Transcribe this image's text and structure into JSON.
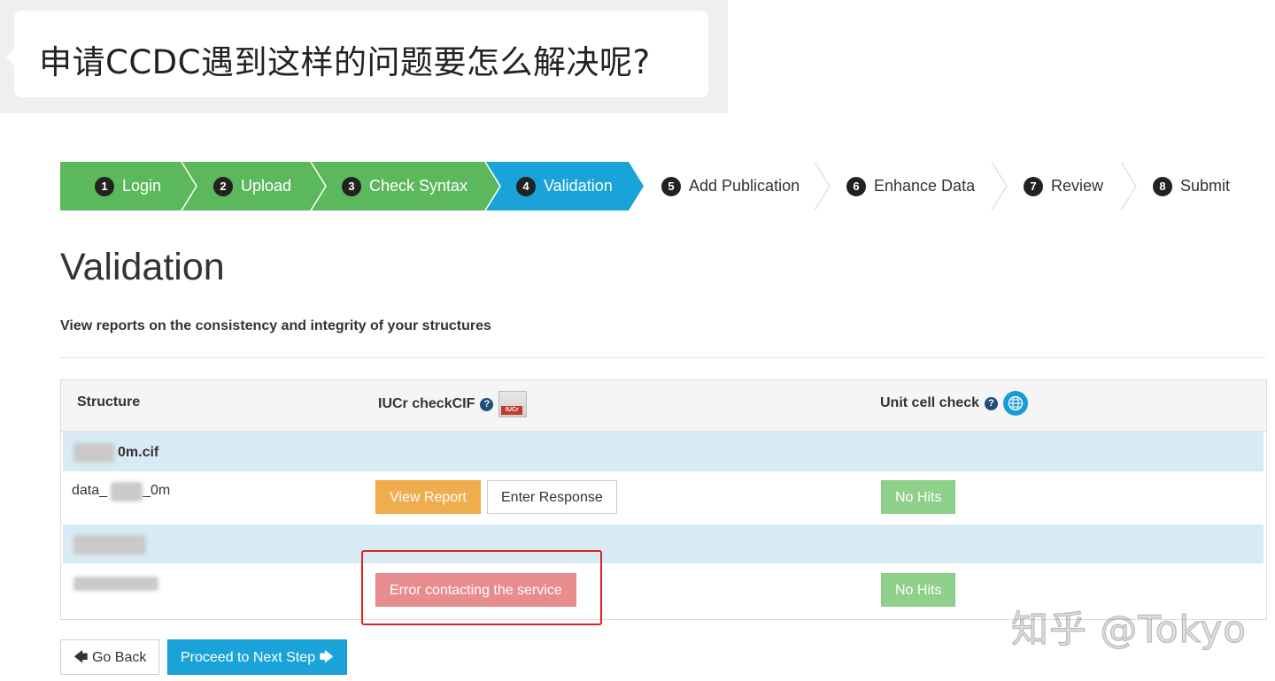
{
  "question": {
    "text": "申请CCDC遇到这样的问题要怎么解决呢?"
  },
  "steps": [
    {
      "num": "1",
      "label": "Login",
      "state": "done"
    },
    {
      "num": "2",
      "label": "Upload",
      "state": "done"
    },
    {
      "num": "3",
      "label": "Check Syntax",
      "state": "done"
    },
    {
      "num": "4",
      "label": "Validation",
      "state": "active"
    },
    {
      "num": "5",
      "label": "Add Publication",
      "state": "todo"
    },
    {
      "num": "6",
      "label": "Enhance Data",
      "state": "todo"
    },
    {
      "num": "7",
      "label": "Review",
      "state": "todo"
    },
    {
      "num": "8",
      "label": "Submit",
      "state": "todo"
    }
  ],
  "colors": {
    "done": "#5cb85c",
    "active": "#1aa3d8",
    "todo": "#ffffff",
    "danger_outline": "#e02020"
  },
  "page": {
    "title": "Validation",
    "subtitle": "View reports on the consistency and integrity of your structures"
  },
  "table": {
    "headers": {
      "structure": "Structure",
      "checkcif": "IUCr checkCIF",
      "unitcell": "Unit cell check"
    },
    "help_glyph": "?",
    "iucr_logo_text": "IUCr",
    "groups": [
      {
        "file_name": "0m.cif",
        "row": {
          "data_prefix": "data_",
          "data_suffix": "_0m",
          "view_report": "View Report",
          "enter_response": "Enter Response",
          "unit_cell": "No Hits"
        }
      },
      {
        "file_name": "",
        "row": {
          "error": "Error contacting the service",
          "unit_cell": "No Hits"
        }
      }
    ]
  },
  "footer": {
    "back_arrow": "🡄",
    "back_label": "Go Back",
    "next_label": "Proceed to Next Step",
    "next_arrow": "🡆"
  },
  "watermark": {
    "text": "知乎 @Tokyo"
  },
  "icons": [
    "help-icon",
    "iucr-logo",
    "globe-icon",
    "arrow-left-icon",
    "arrow-right-icon"
  ]
}
